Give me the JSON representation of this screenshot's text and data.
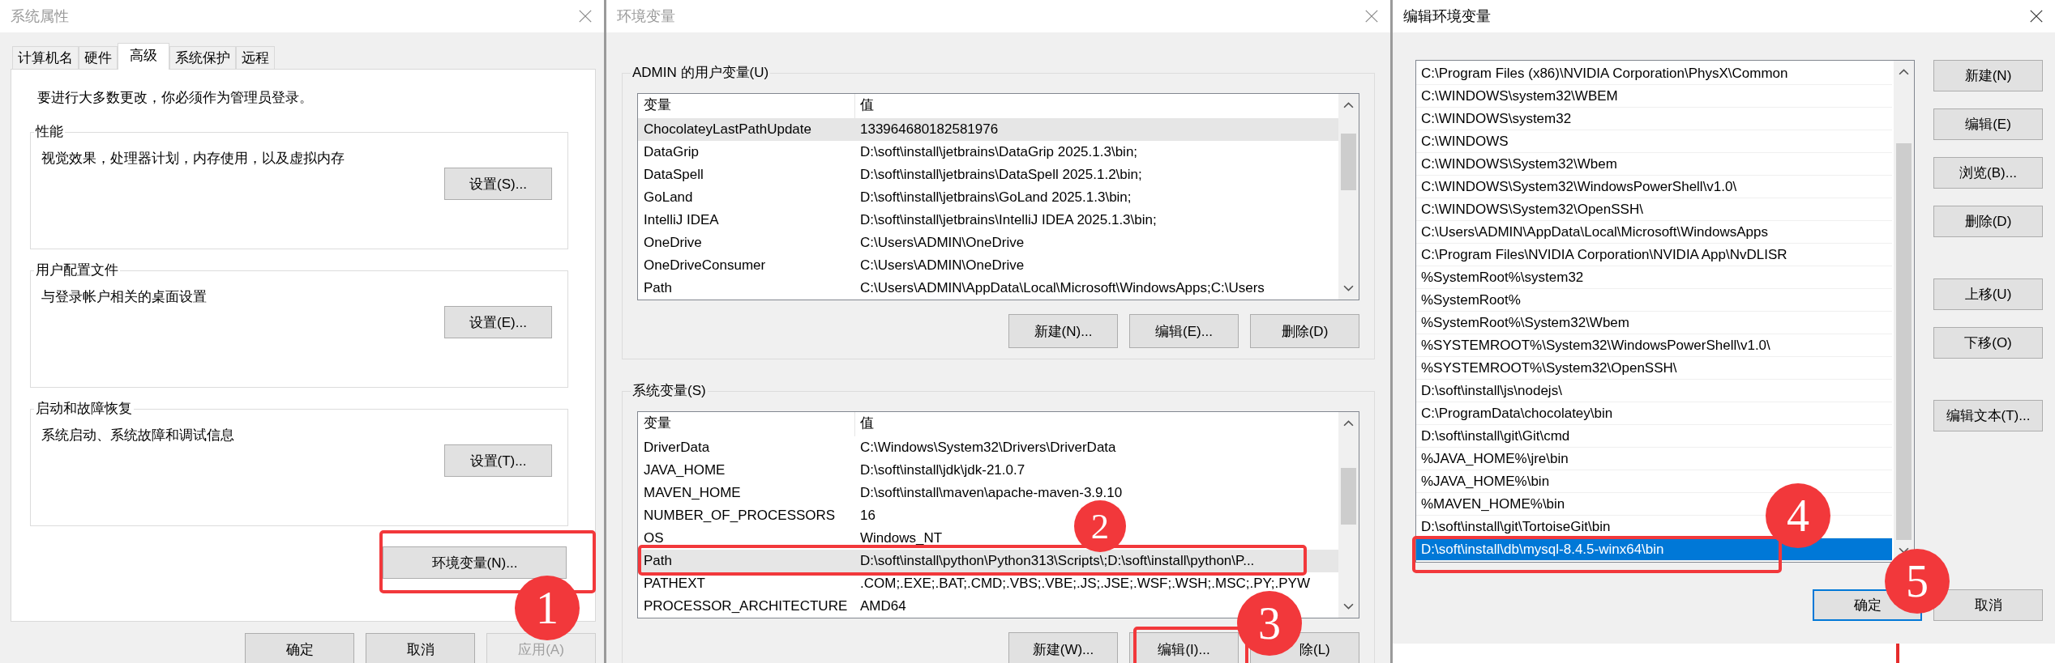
{
  "system_properties": {
    "title": "系统属性",
    "active": false,
    "tabs": [
      {
        "label": "计算机名",
        "selected": false
      },
      {
        "label": "硬件",
        "selected": false
      },
      {
        "label": "高级",
        "selected": true
      },
      {
        "label": "系统保护",
        "selected": false
      },
      {
        "label": "远程",
        "selected": false
      }
    ],
    "notice": "要进行大多数更改，你必须作为管理员登录。",
    "groups": [
      {
        "title": "性能",
        "description": "视觉效果，处理器计划，内存使用，以及虚拟内存",
        "button": "设置(S)..."
      },
      {
        "title": "用户配置文件",
        "description": "与登录帐户相关的桌面设置",
        "button": "设置(E)..."
      },
      {
        "title": "启动和故障恢复",
        "description": "系统启动、系统故障和调试信息",
        "button": "设置(T)..."
      }
    ],
    "env_button": "环境变量(N)...",
    "buttons": [
      {
        "label": "确定",
        "disabled": false
      },
      {
        "label": "取消",
        "disabled": false
      },
      {
        "label": "应用(A)",
        "disabled": true
      }
    ]
  },
  "environment_variables": {
    "title": "环境变量",
    "active": false,
    "user_variables": {
      "title": "ADMIN 的用户变量(U)",
      "columns": [
        "变量",
        "值"
      ],
      "rows": [
        {
          "name": "ChocolateyLastPathUpdate",
          "value": "133964680182581976",
          "selected": true
        },
        {
          "name": "DataGrip",
          "value": "D:\\soft\\install\\jetbrains\\DataGrip 2025.1.3\\bin;",
          "selected": false
        },
        {
          "name": "DataSpell",
          "value": "D:\\soft\\install\\jetbrains\\DataSpell 2025.1.2\\bin;",
          "selected": false
        },
        {
          "name": "GoLand",
          "value": "D:\\soft\\install\\jetbrains\\GoLand 2025.1.3\\bin;",
          "selected": false
        },
        {
          "name": "IntelliJ IDEA",
          "value": "D:\\soft\\install\\jetbrains\\IntelliJ IDEA 2025.1.3\\bin;",
          "selected": false
        },
        {
          "name": "OneDrive",
          "value": "C:\\Users\\ADMIN\\OneDrive",
          "selected": false
        },
        {
          "name": "OneDriveConsumer",
          "value": "C:\\Users\\ADMIN\\OneDrive",
          "selected": false
        },
        {
          "name": "Path",
          "value": "C:\\Users\\ADMIN\\AppData\\Local\\Microsoft\\WindowsApps;C:\\Users",
          "selected": false
        }
      ],
      "buttons": [
        "新建(N)...",
        "编辑(E)...",
        "删除(D)"
      ]
    },
    "system_variables": {
      "title": "系统变量(S)",
      "columns": [
        "变量",
        "值"
      ],
      "rows": [
        {
          "name": "DriverData",
          "value": "C:\\Windows\\System32\\Drivers\\DriverData",
          "selected": false
        },
        {
          "name": "JAVA_HOME",
          "value": "D:\\soft\\install\\jdk\\jdk-21.0.7",
          "selected": false
        },
        {
          "name": "MAVEN_HOME",
          "value": "D:\\soft\\install\\maven\\apache-maven-3.9.10",
          "selected": false
        },
        {
          "name": "NUMBER_OF_PROCESSORS",
          "value": "16",
          "selected": false
        },
        {
          "name": "OS",
          "value": "Windows_NT",
          "selected": false
        },
        {
          "name": "Path",
          "value": "D:\\soft\\install\\python\\Python313\\Scripts\\;D:\\soft\\install\\python\\P...",
          "selected": true
        },
        {
          "name": "PATHEXT",
          "value": ".COM;.EXE;.BAT;.CMD;.VBS;.VBE;.JS;.JSE;.WSF;.WSH;.MSC;.PY;.PYW",
          "selected": false
        },
        {
          "name": "PROCESSOR_ARCHITECTURE",
          "value": "AMD64",
          "selected": false
        }
      ],
      "buttons": [
        "新建(W)...",
        "编辑(I)...",
        "除(L)"
      ]
    }
  },
  "edit_dialog": {
    "title": "编辑环境变量",
    "active": true,
    "entries": [
      {
        "text": "C:\\Program Files (x86)\\NVIDIA Corporation\\PhysX\\Common",
        "selected": false
      },
      {
        "text": "C:\\WINDOWS\\system32\\WBEM",
        "selected": false
      },
      {
        "text": "C:\\WINDOWS\\system32",
        "selected": false
      },
      {
        "text": "C:\\WINDOWS",
        "selected": false
      },
      {
        "text": "C:\\WINDOWS\\System32\\Wbem",
        "selected": false
      },
      {
        "text": "C:\\WINDOWS\\System32\\WindowsPowerShell\\v1.0\\",
        "selected": false
      },
      {
        "text": "C:\\WINDOWS\\System32\\OpenSSH\\",
        "selected": false
      },
      {
        "text": "C:\\Users\\ADMIN\\AppData\\Local\\Microsoft\\WindowsApps",
        "selected": false
      },
      {
        "text": "C:\\Program Files\\NVIDIA Corporation\\NVIDIA App\\NvDLISR",
        "selected": false
      },
      {
        "text": "%SystemRoot%\\system32",
        "selected": false
      },
      {
        "text": "%SystemRoot%",
        "selected": false
      },
      {
        "text": "%SystemRoot%\\System32\\Wbem",
        "selected": false
      },
      {
        "text": "%SYSTEMROOT%\\System32\\WindowsPowerShell\\v1.0\\",
        "selected": false
      },
      {
        "text": "%SYSTEMROOT%\\System32\\OpenSSH\\",
        "selected": false
      },
      {
        "text": "D:\\soft\\install\\js\\nodejs\\",
        "selected": false
      },
      {
        "text": "C:\\ProgramData\\chocolatey\\bin",
        "selected": false
      },
      {
        "text": "D:\\soft\\install\\git\\Git\\cmd",
        "selected": false
      },
      {
        "text": "%JAVA_HOME%\\jre\\bin",
        "selected": false
      },
      {
        "text": "%JAVA_HOME%\\bin",
        "selected": false
      },
      {
        "text": "%MAVEN_HOME%\\bin",
        "selected": false
      },
      {
        "text": "D:\\soft\\install\\git\\TortoiseGit\\bin",
        "selected": false
      },
      {
        "text": "D:\\soft\\install\\db\\mysql-8.4.5-winx64\\bin",
        "selected": true
      }
    ],
    "side_button_groups": [
      [
        "新建(N)",
        "编辑(E)",
        "浏览(B)...",
        "删除(D)"
      ],
      [
        "上移(U)",
        "下移(O)"
      ],
      [
        "编辑文本(T)..."
      ]
    ],
    "buttons": [
      {
        "label": "确定",
        "default": true
      },
      {
        "label": "取消",
        "default": false
      }
    ]
  },
  "annotations": [
    {
      "label": "1"
    },
    {
      "label": "2"
    },
    {
      "label": "3"
    },
    {
      "label": "4"
    },
    {
      "label": "5"
    }
  ]
}
